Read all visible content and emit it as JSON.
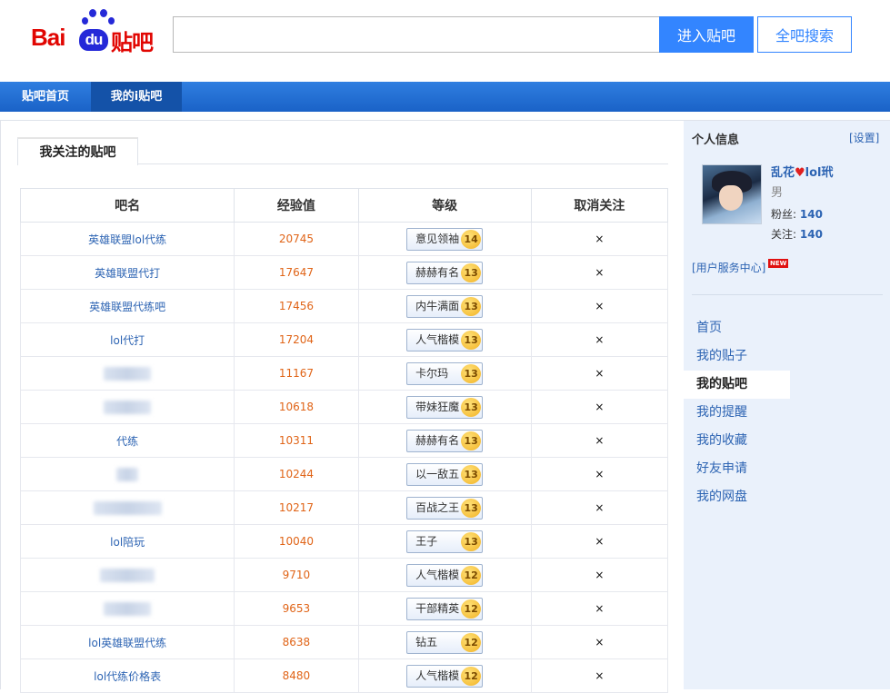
{
  "header": {
    "logo": {
      "bai": "Bai",
      "du": "du",
      "cn": "贴吧"
    },
    "search_placeholder": "",
    "enter_btn": "进入贴吧",
    "search_all_btn": "全吧搜索"
  },
  "nav": {
    "home": "贴吧首页",
    "my": "我的i贴吧"
  },
  "tab": "我关注的贴吧",
  "table": {
    "headers": [
      "吧名",
      "经验值",
      "等级",
      "取消关注"
    ],
    "rows": [
      {
        "name": "英雄联盟lol代练",
        "exp": "20745",
        "title": "意见领袖",
        "level": "14"
      },
      {
        "name": "英雄联盟代打",
        "exp": "17647",
        "title": "赫赫有名",
        "level": "13"
      },
      {
        "name": "英雄联盟代练吧",
        "exp": "17456",
        "title": "内牛满面",
        "level": "13"
      },
      {
        "name": "lol代打",
        "exp": "17204",
        "title": "人气楷模",
        "level": "13"
      },
      {
        "name": "",
        "exp": "11167",
        "title": "卡尔玛",
        "level": "13"
      },
      {
        "name": "",
        "exp": "10618",
        "title": "带妹狂魔",
        "level": "13"
      },
      {
        "name": "代练",
        "exp": "10311",
        "title": "赫赫有名",
        "level": "13"
      },
      {
        "name": "",
        "exp": "10244",
        "title": "以一敌五",
        "level": "13"
      },
      {
        "name": "",
        "exp": "10217",
        "title": "百战之王",
        "level": "13"
      },
      {
        "name": "lol陪玩",
        "exp": "10040",
        "title": "王子",
        "level": "13"
      },
      {
        "name": "",
        "exp": "9710",
        "title": "人气楷模",
        "level": "12"
      },
      {
        "name": "",
        "exp": "9653",
        "title": "干部精英",
        "level": "12"
      },
      {
        "name": "lol英雄联盟代练",
        "exp": "8638",
        "title": "钻五",
        "level": "12"
      },
      {
        "name": "lol代练价格表",
        "exp": "8480",
        "title": "人气楷模",
        "level": "12"
      }
    ],
    "unfollow_symbol": "×"
  },
  "sidebar": {
    "title": "个人信息",
    "settings": "[设置]",
    "username_a": "乱花",
    "username_heart": "♥",
    "username_b": "lol玳",
    "gender": "男",
    "fans_label": "粉丝:",
    "fans": "140",
    "follow_label": "关注:",
    "follow": "140",
    "service": "[用户服务中心]",
    "new_tag": "NEW",
    "menu": [
      "首页",
      "我的贴子",
      "我的贴吧",
      "我的提醒",
      "我的收藏",
      "好友申请",
      "我的网盘"
    ],
    "active_index": 2
  }
}
